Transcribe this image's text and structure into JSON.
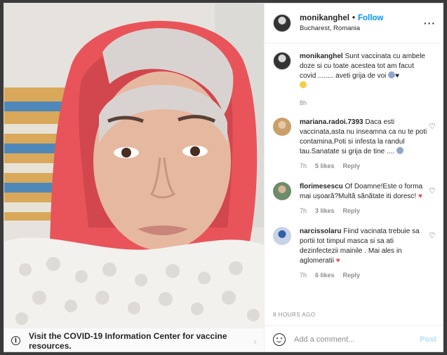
{
  "post": {
    "username": "monikanghel",
    "follow_label": "Follow",
    "location": "Bucharest, Romania",
    "time_ago": "8 HOURS AGO"
  },
  "banner": {
    "text": "Visit the COVID-19 Information Center for vaccine resources."
  },
  "caption": {
    "username": "monikanghel",
    "text": "Sunt vaccinata cu ambele doze si cu toate acestea tot am facut covid ........ aveti grija de voi",
    "time": "8h"
  },
  "comments": [
    {
      "username": "mariana.radoi.7393",
      "text": "Daca esti vaccinata,asta nu inseamna ca nu te poti contamina.Poti si infesta la randul tau.Sanatate si grija de tine ....",
      "time": "7h",
      "likes": "5 likes",
      "reply": "Reply"
    },
    {
      "username": "florimesescu",
      "text": "Of Doamne!Este o forma mai ușoară?Multă sănătate iti doresc!",
      "time": "7h",
      "likes": "3 likes",
      "reply": "Reply"
    },
    {
      "username": "narcissolaru",
      "text": "Fiind vacinata trebuie sa portii tot timpul masca si sa ati dezinfectezii mainile . Mai ales in aglomeratii",
      "time": "7h",
      "likes": "6 likes",
      "reply": "Reply"
    }
  ],
  "add_comment": {
    "placeholder": "Add a comment...",
    "post_label": "Post"
  },
  "colors": {
    "accent": "#0095f6",
    "muted": "#8e8e8e",
    "heart": "#ed4956",
    "scarf": "#e8545a"
  },
  "icons": {
    "info": "info-icon",
    "chevron": "chevron-right-icon",
    "more": "more-options-icon",
    "like": "heart-icon",
    "emoji": "smile-icon"
  }
}
